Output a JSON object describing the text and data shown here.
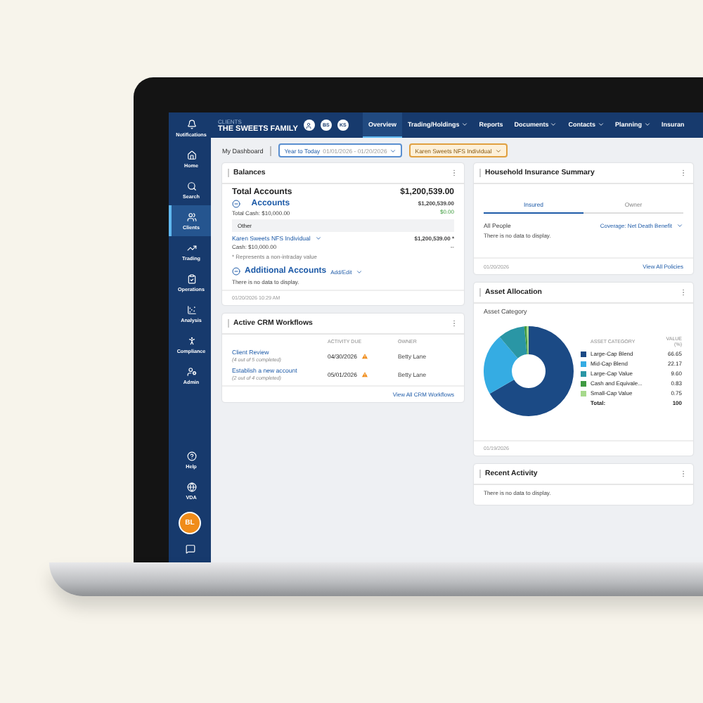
{
  "sidebar": {
    "items": [
      {
        "label": "Notifications",
        "selected": false
      },
      {
        "label": "Home",
        "selected": false
      },
      {
        "label": "Search",
        "selected": false
      },
      {
        "label": "Clients",
        "selected": true
      },
      {
        "label": "Trading",
        "selected": false
      },
      {
        "label": "Operations",
        "selected": false
      },
      {
        "label": "Analysis",
        "selected": false
      },
      {
        "label": "Compliance",
        "selected": false
      },
      {
        "label": "Admin",
        "selected": false
      }
    ],
    "bottom_items": [
      {
        "label": "Help"
      },
      {
        "label": "VDA"
      }
    ],
    "avatar": "BL"
  },
  "header": {
    "caption": "CLIENTS",
    "client_name": "THE SWEETS FAMILY",
    "badges": [
      "BS",
      "KS"
    ]
  },
  "nav": [
    {
      "label": "Overview",
      "selected": true,
      "dropdown": false
    },
    {
      "label": "Trading/Holdings",
      "selected": false,
      "dropdown": true
    },
    {
      "label": "Reports",
      "selected": false,
      "dropdown": false
    },
    {
      "label": "Documents",
      "selected": false,
      "dropdown": true
    },
    {
      "label": "Contacts",
      "selected": false,
      "dropdown": true
    },
    {
      "label": "Planning",
      "selected": false,
      "dropdown": true
    },
    {
      "label": "Insuran",
      "selected": false,
      "dropdown": false
    }
  ],
  "toolbar": {
    "title": "My Dashboard",
    "date_filter": {
      "label": "Year to Today",
      "range": "01/01/2026 - 01/20/2026"
    },
    "account_filter": "Karen Sweets NFS Individual"
  },
  "balances": {
    "title": "Balances",
    "total_label": "Total Accounts",
    "total_value": "$1,200,539.00",
    "accounts": {
      "label": "Accounts",
      "expanded": true,
      "value": "$1,200,539.00",
      "cash": "Total Cash: $10,000.00",
      "cash_value": "$0.00"
    },
    "group": "Other",
    "account": {
      "name": "Karen Sweets NFS Individual",
      "cash": "Cash: $10,000.00",
      "value": "$1,200,539.00 *",
      "change": "--"
    },
    "footnote": "* Represents a non-intraday value",
    "additional": {
      "label": "Additional Accounts",
      "expanded": true,
      "action": "Add/Edit"
    },
    "empty": "There is no data to display.",
    "timestamp": "01/20/2026 10:29 AM"
  },
  "crm": {
    "title": "Active CRM Workflows",
    "columns": [
      "ACTIVITY DUE",
      "OWNER"
    ],
    "rows": [
      {
        "name": "Client Review",
        "progress": "(4 out of 5 completed)",
        "due": "04/30/2026",
        "warning": true,
        "owner": "Betty Lane"
      },
      {
        "name": "Establish a new account",
        "progress": "(2 out of 4 completed)",
        "due": "05/01/2026",
        "warning": true,
        "owner": "Betty Lane"
      }
    ],
    "link": "View All CRM Workflows"
  },
  "insurance": {
    "title": "Household Insurance Summary",
    "tabs": [
      {
        "label": "Insured",
        "selected": true
      },
      {
        "label": "Owner",
        "selected": false
      }
    ],
    "filter_label": "All People",
    "coverage": "Coverage: Net Death Benefit",
    "empty": "There is no data to display.",
    "timestamp": "01/20/2026",
    "link": "View All Policies"
  },
  "allocation": {
    "title": "Asset Allocation",
    "subtitle": "Asset Category",
    "columns": [
      "ASSET CATEGORY"
    ],
    "rows": [
      {
        "color": "#1b4a85",
        "value": "66.65"
      },
      {
        "color": "#35ace3",
        "value": "22.17"
      },
      {
        "color": "#2a96a5",
        "value": "9.60"
      },
      {
        "color": "#3f9a42",
        "value": "0.83"
      },
      {
        "color": "#a6d98c",
        "value": "0.75"
      }
    ],
    "total_label": "Total:",
    "total_value": "100",
    "timestamp": "01/19/2026",
    "chart_data": {
      "type": "donut",
      "categories": [
        "Large-Cap Blend",
        "Mid-Cap Blend",
        "Large-Cap Value",
        "Cash and Equivale...",
        "Small-Cap Value"
      ],
      "series": [
        {
          "name": "VALUE (%)",
          "values": [
            66.65,
            22.17,
            9.6,
            0.83,
            0.75
          ]
        }
      ]
    }
  },
  "recent": {
    "title": "Recent Activity",
    "empty": "There is no data to display."
  }
}
